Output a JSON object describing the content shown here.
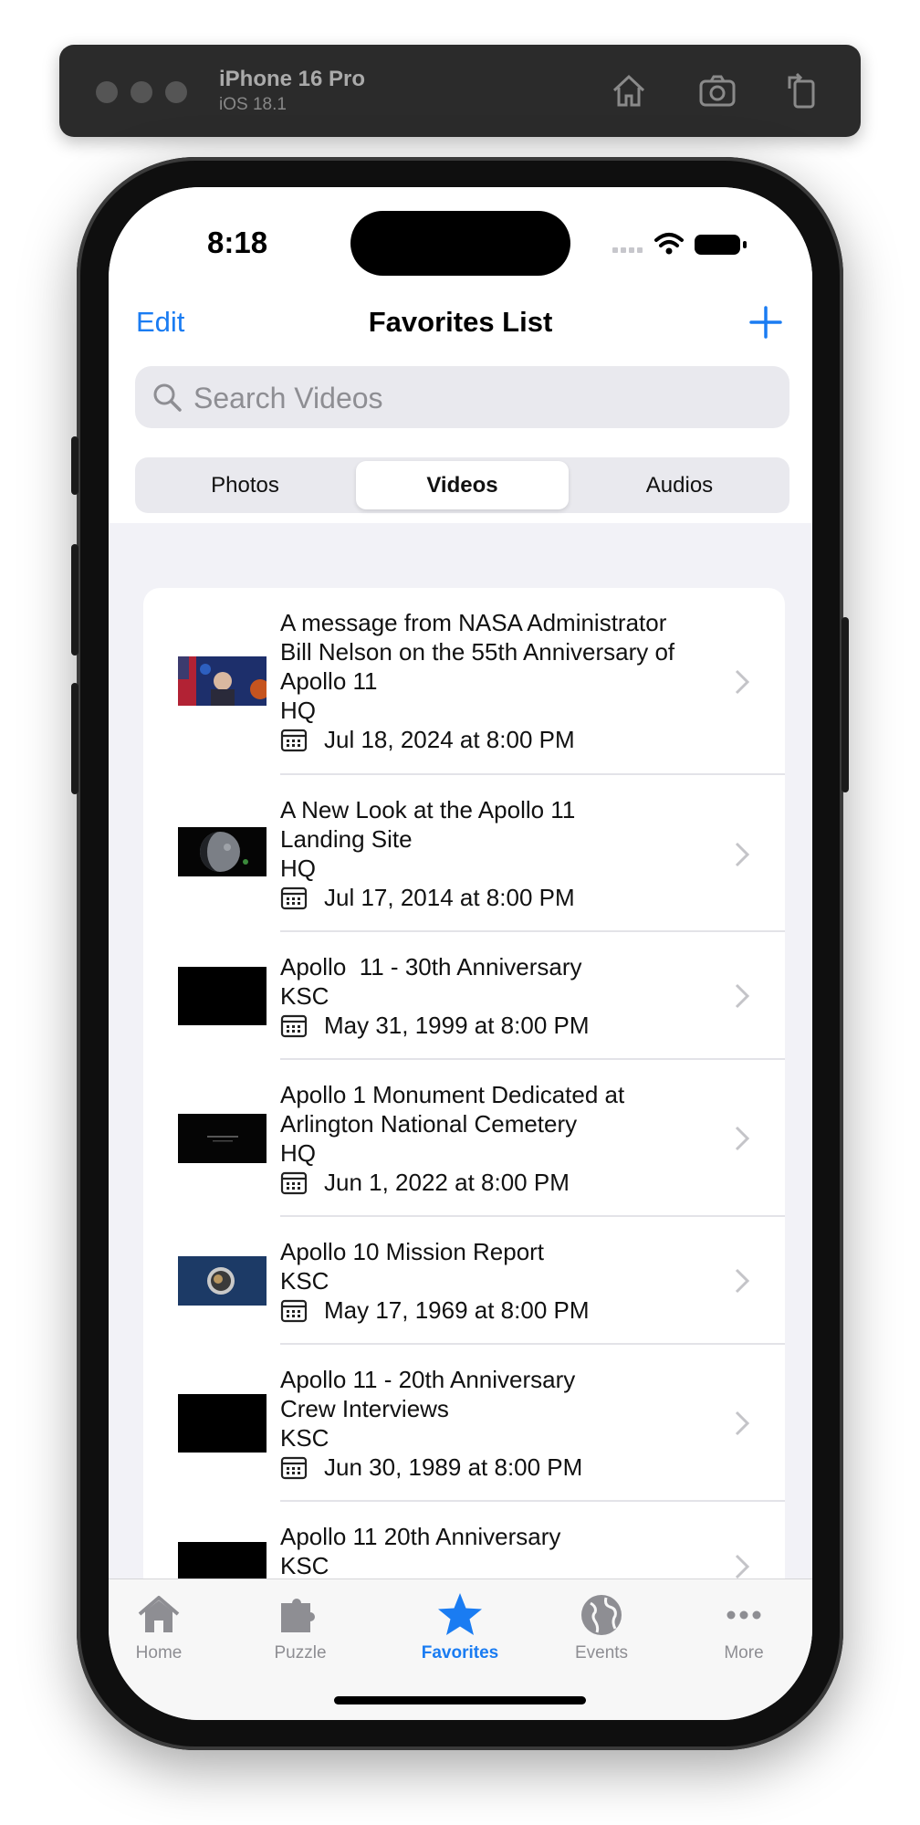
{
  "simulator": {
    "device": "iPhone 16 Pro",
    "os": "iOS 18.1"
  },
  "status_bar": {
    "time": "8:18"
  },
  "nav": {
    "edit_label": "Edit",
    "title": "Favorites List"
  },
  "search": {
    "placeholder": "Search Videos"
  },
  "segments": [
    {
      "label": "Photos",
      "selected": false
    },
    {
      "label": "Videos",
      "selected": true
    },
    {
      "label": "Audios",
      "selected": false
    }
  ],
  "videos": [
    {
      "title_lines": [
        "A message from NASA Administrator",
        "Bill Nelson on the 55th Anniversary of",
        "Apollo 11"
      ],
      "center": "HQ",
      "date": "Jul 18, 2024 at 8:00 PM"
    },
    {
      "title_lines": [
        "A New Look at the Apollo 11",
        "Landing Site"
      ],
      "center": "HQ",
      "date": "Jul 17, 2014 at 8:00 PM"
    },
    {
      "title_lines": [
        "Apollo  11 - 30th Anniversary"
      ],
      "center": "KSC",
      "date": "May 31, 1999 at 8:00 PM"
    },
    {
      "title_lines": [
        "Apollo 1 Monument Dedicated at",
        "Arlington National Cemetery"
      ],
      "center": "HQ",
      "date": "Jun 1, 2022 at 8:00 PM"
    },
    {
      "title_lines": [
        "Apollo 10 Mission Report"
      ],
      "center": "KSC",
      "date": "May 17, 1969 at 8:00 PM"
    },
    {
      "title_lines": [
        "Apollo 11 - 20th Anniversary",
        "Crew Interviews"
      ],
      "center": "KSC",
      "date": "Jun 30, 1989 at 8:00 PM"
    },
    {
      "title_lines": [
        "Apollo 11 20th Anniversary"
      ],
      "center": "KSC",
      "date": ""
    }
  ],
  "tabs": [
    {
      "label": "Home",
      "icon": "house-icon",
      "active": false
    },
    {
      "label": "Puzzle",
      "icon": "puzzle-icon",
      "active": false
    },
    {
      "label": "Favorites",
      "icon": "star-icon",
      "active": true
    },
    {
      "label": "Events",
      "icon": "globe-icon",
      "active": false
    },
    {
      "label": "More",
      "icon": "more-icon",
      "active": false
    }
  ],
  "colors": {
    "accent": "#1a7cf2",
    "inactive_tab": "#8e8e93",
    "list_background": "#f2f2f7"
  }
}
